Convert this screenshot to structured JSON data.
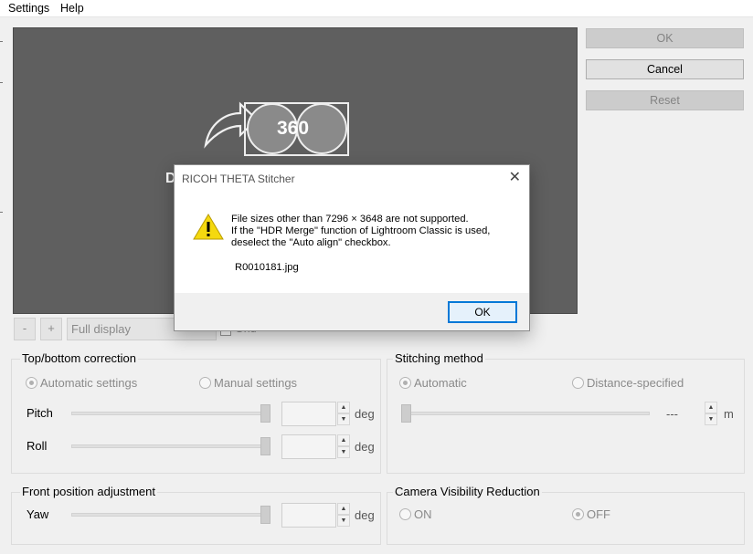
{
  "menu": {
    "settings": "Settings",
    "help": "Help"
  },
  "buttons": {
    "ok": "OK",
    "cancel": "Cancel",
    "reset": "Reset"
  },
  "preview": {
    "logo_text": "360",
    "behind_dialog_letter": "D"
  },
  "zoom": {
    "minus": "-",
    "plus": "+",
    "display_mode": "Full display",
    "grid_label": "Grid"
  },
  "top_bottom": {
    "title": "Top/bottom correction",
    "auto_label": "Automatic settings",
    "manual_label": "Manual settings",
    "pitch_label": "Pitch",
    "roll_label": "Roll",
    "unit": "deg"
  },
  "stitching": {
    "title": "Stitching method",
    "auto_label": "Automatic",
    "distance_label": "Distance-specified",
    "distance_value": "---",
    "unit": "m"
  },
  "front": {
    "title": "Front position adjustment",
    "yaw_label": "Yaw",
    "unit": "deg"
  },
  "camera": {
    "title": "Camera Visibility Reduction",
    "on_label": "ON",
    "off_label": "OFF"
  },
  "dialog": {
    "title": "RICOH THETA Stitcher",
    "message": "File sizes other than 7296 × 3648 are not supported.\nIf the \"HDR Merge\" function of Lightroom Classic is used,\ndeselect the \"Auto align\" checkbox.",
    "filename": "R0010181.jpg",
    "ok_label": "OK",
    "close_glyph": "✕"
  }
}
